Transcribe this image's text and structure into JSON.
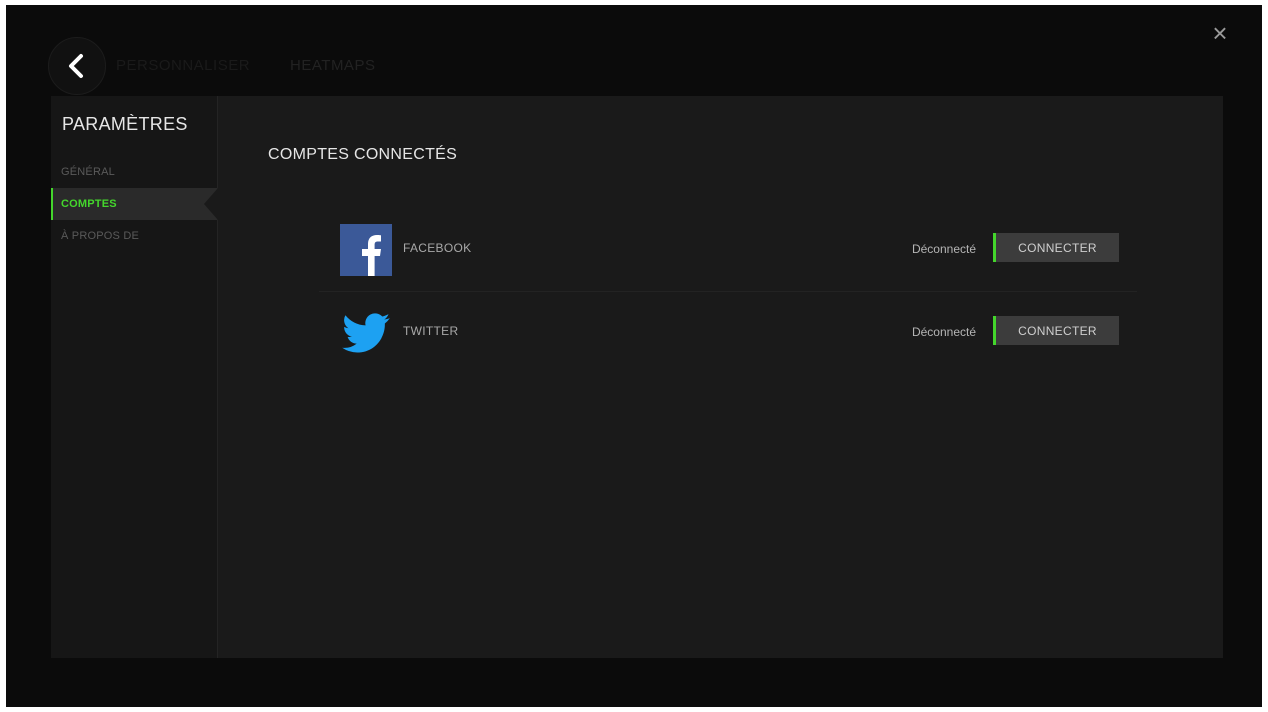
{
  "window": {
    "close_label": "×"
  },
  "header": {
    "tabs": [
      {
        "label": "PERSONNALISER"
      },
      {
        "label": "HEATMAPS"
      }
    ]
  },
  "sidebar": {
    "title": "PARAMÈTRES",
    "items": [
      {
        "label": "GÉNÉRAL",
        "active": false
      },
      {
        "label": "COMPTES",
        "active": true
      },
      {
        "label": "À PROPOS DE",
        "active": false
      }
    ]
  },
  "main": {
    "title": "COMPTES CONNECTÉS",
    "accounts": [
      {
        "name": "FACEBOOK",
        "icon": "facebook-icon",
        "status": "Déconnecté",
        "button_label": "CONNECTER"
      },
      {
        "name": "TWITTER",
        "icon": "twitter-icon",
        "status": "Déconnecté",
        "button_label": "CONNECTER"
      }
    ]
  },
  "colors": {
    "accent": "#44d62c",
    "facebook": "#3b5998",
    "twitter": "#1da1f2"
  }
}
